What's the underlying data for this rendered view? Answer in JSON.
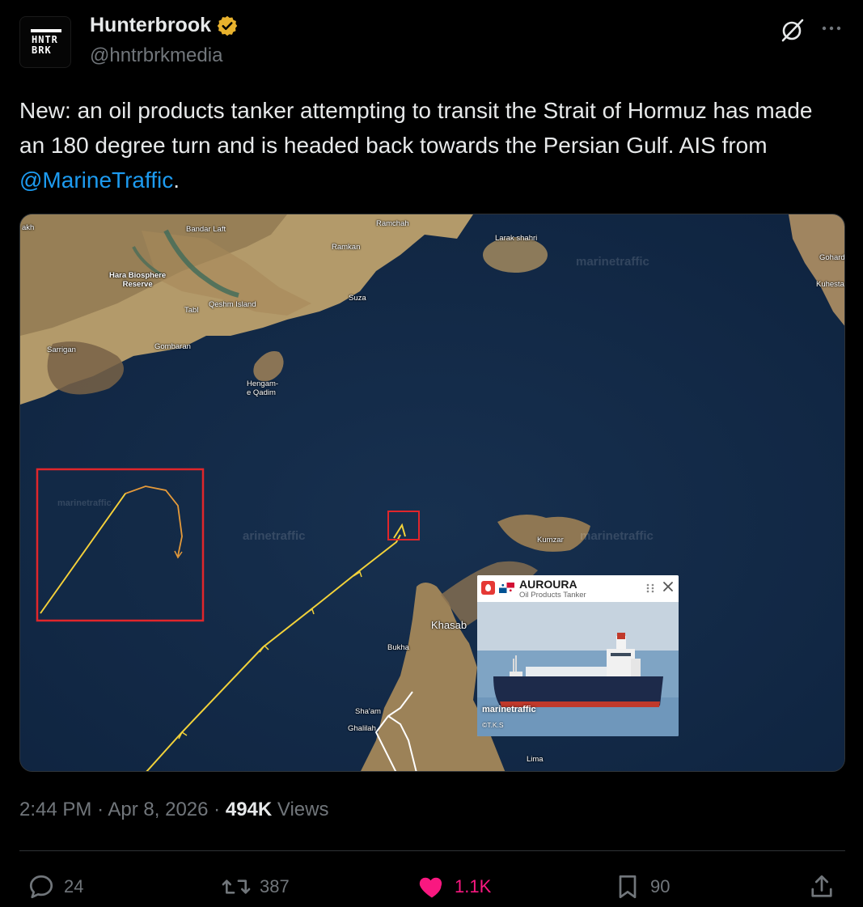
{
  "author": {
    "avatar_line1": "HNTR",
    "avatar_line2": "BRK",
    "display_name": "Hunterbrook",
    "verified": true,
    "handle": "@hntrbrkmedia"
  },
  "tweet": {
    "text_before": "New: an oil products tanker attempting to transit the Strait of Hormuz has made an 180 degree turn and is headed back towards the Persian Gulf. AIS from ",
    "mention": "@MarineTraffic",
    "text_after": "."
  },
  "map": {
    "places": {
      "nakh": "akh",
      "bandar_laft": "Bandar Laft",
      "ramchah": "Ramchah",
      "ramkan": "Ramkan",
      "larak": "Larak shahri",
      "gohard": "Gohard",
      "kuhestak": "Kuhesta",
      "hara": "Hara Biosphere\nReserve",
      "tabl": "Tabl",
      "qeshm": "Qeshm Island",
      "suza": "Suza",
      "sarrigan": "Sarrigan",
      "gombaran": "Gombaran",
      "hengam": "Hengam-\ne Qadim",
      "kumzar": "Kumzar",
      "khasab": "Khasab",
      "bukha": "Bukha",
      "shaam": "Sha'am",
      "ghalilah": "Ghalilah",
      "lima": "Lima"
    },
    "watermarks": [
      "marinetraffic",
      "marinetraffic",
      "arinetraffic",
      "marinetraffic"
    ],
    "vessel_popup": {
      "name": "AUROURA",
      "type": "Oil Products Tanker",
      "photo_brand": "marinetraffic",
      "photo_credit": "©T.K.S"
    },
    "colors": {
      "sea": "#132a48",
      "track": "#f2d23a",
      "turn_track": "#e59a3a",
      "highlight_box": "#e0262b"
    }
  },
  "meta": {
    "time": "2:44 PM",
    "separator": "·",
    "date": "Apr 8, 2026",
    "views_count": "494K",
    "views_label": "Views"
  },
  "actions": {
    "replies": "24",
    "reposts": "387",
    "likes": "1.1K",
    "bookmarks": "90"
  },
  "colors": {
    "background": "#000000",
    "text_primary": "#e7e9ea",
    "text_secondary": "#71767b",
    "link": "#1d9bf0",
    "like": "#f91880",
    "verified_badge": "#e8b22d"
  }
}
